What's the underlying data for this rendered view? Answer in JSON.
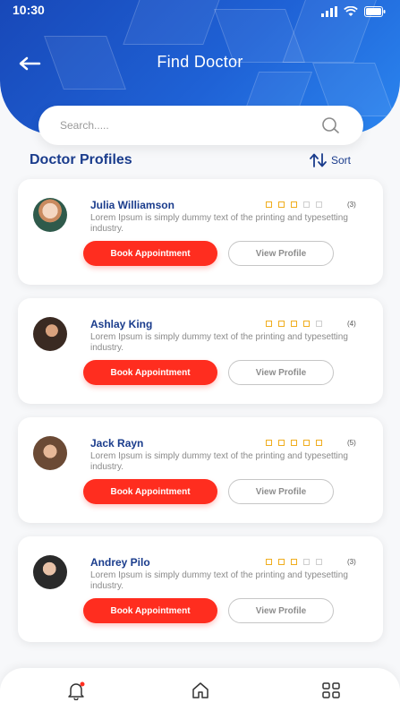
{
  "status": {
    "time": "10:30"
  },
  "header": {
    "title": "Find Doctor"
  },
  "search": {
    "placeholder": "Search....."
  },
  "section": {
    "title": "Doctor Profiles",
    "sort_label": "Sort"
  },
  "buttons": {
    "book": "Book Appointment",
    "view": "View Profile"
  },
  "colors": {
    "brand_blue": "#1f56c8",
    "accent_red": "#ff2d1f",
    "star": "#f0ad1e"
  },
  "doctors": [
    {
      "name": "Julia Williamson",
      "description": "Lorem Ipsum is simply dummy text of the printing and typesetting industry.",
      "rating": 3,
      "rating_label": "(3)"
    },
    {
      "name": "Ashlay King",
      "description": "Lorem Ipsum is simply dummy text of the printing and typesetting industry.",
      "rating": 4,
      "rating_label": "(4)"
    },
    {
      "name": "Jack Rayn",
      "description": "Lorem Ipsum is simply dummy text of the printing and typesetting industry.",
      "rating": 5,
      "rating_label": "(5)"
    },
    {
      "name": "Andrey Pilo",
      "description": "Lorem Ipsum is simply dummy text of the printing and typesetting industry.",
      "rating": 3,
      "rating_label": "(3)"
    }
  ],
  "nav": [
    {
      "icon": "bell-icon",
      "has_notification": true
    },
    {
      "icon": "home-icon"
    },
    {
      "icon": "grid-icon"
    }
  ]
}
